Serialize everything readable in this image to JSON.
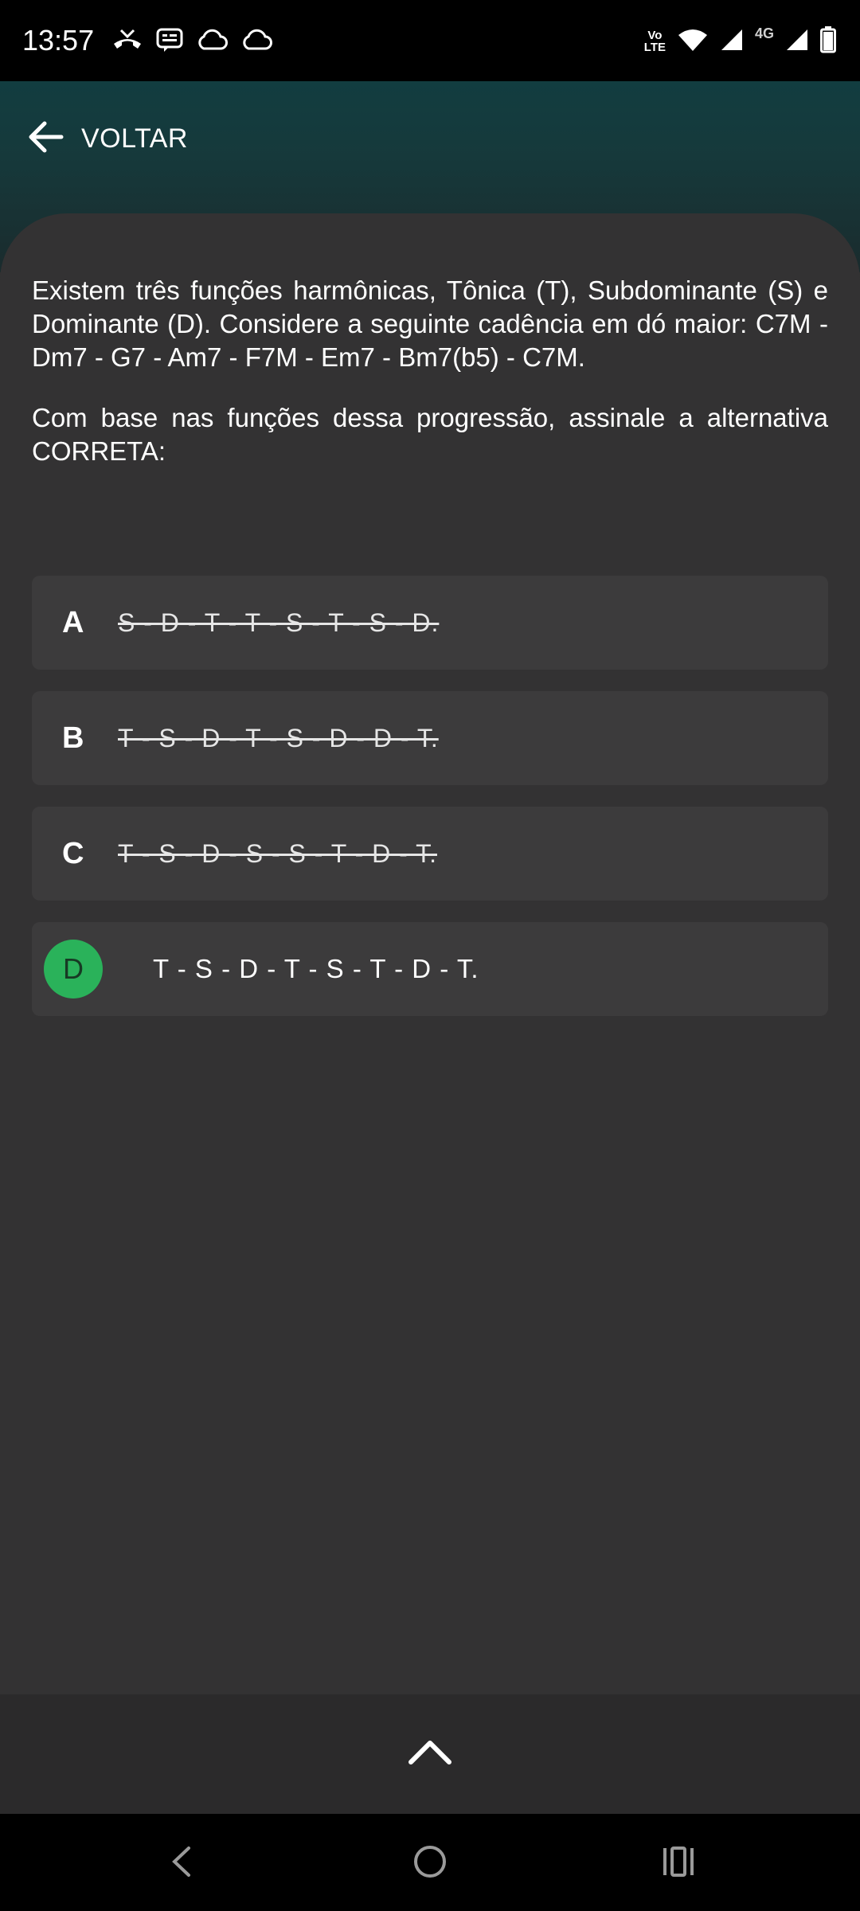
{
  "status_bar": {
    "time": "13:57",
    "left_icons": [
      "missed-call-icon",
      "message-icon",
      "cloud-icon",
      "cloud-icon"
    ],
    "right_icons": [
      "volte-icon",
      "wifi-icon",
      "signal-icon",
      "signal-4g-icon",
      "battery-icon"
    ],
    "volte_line1": "Vo",
    "volte_line2": "LTE",
    "network_label": "4G"
  },
  "header": {
    "back_label": "VOLTAR",
    "back_icon": "arrow-left-icon"
  },
  "question": {
    "paragraph1": "Existem três funções harmônicas, Tônica (T), Subdominante (S) e Dominante (D). Considere a seguinte cadência em dó maior: C7M - Dm7 - G7 - Am7 - F7M - Em7 - Bm7(b5) - C7M.",
    "paragraph2": "Com base nas funções dessa progressão, assinale a alternativa CORRETA:"
  },
  "options": [
    {
      "letter": "A",
      "text": "S - D - T - T - S - T - S - D.",
      "state": "eliminated"
    },
    {
      "letter": "B",
      "text": "T - S - D - T - S - D - D - T.",
      "state": "eliminated"
    },
    {
      "letter": "C",
      "text": "T - S - D - S - S - T - D - T.",
      "state": "eliminated"
    },
    {
      "letter": "D",
      "text": "T - S - D - T - S - T - D - T.",
      "state": "correct"
    }
  ],
  "colors": {
    "correct_badge": "#2ab25a",
    "background": "#333233",
    "header_gradient_top": "#123d40"
  },
  "bottom_bar": {
    "expand_icon": "chevron-up-icon"
  },
  "nav_bar": {
    "icons": [
      "nav-back-icon",
      "nav-home-icon",
      "nav-recents-icon"
    ]
  }
}
